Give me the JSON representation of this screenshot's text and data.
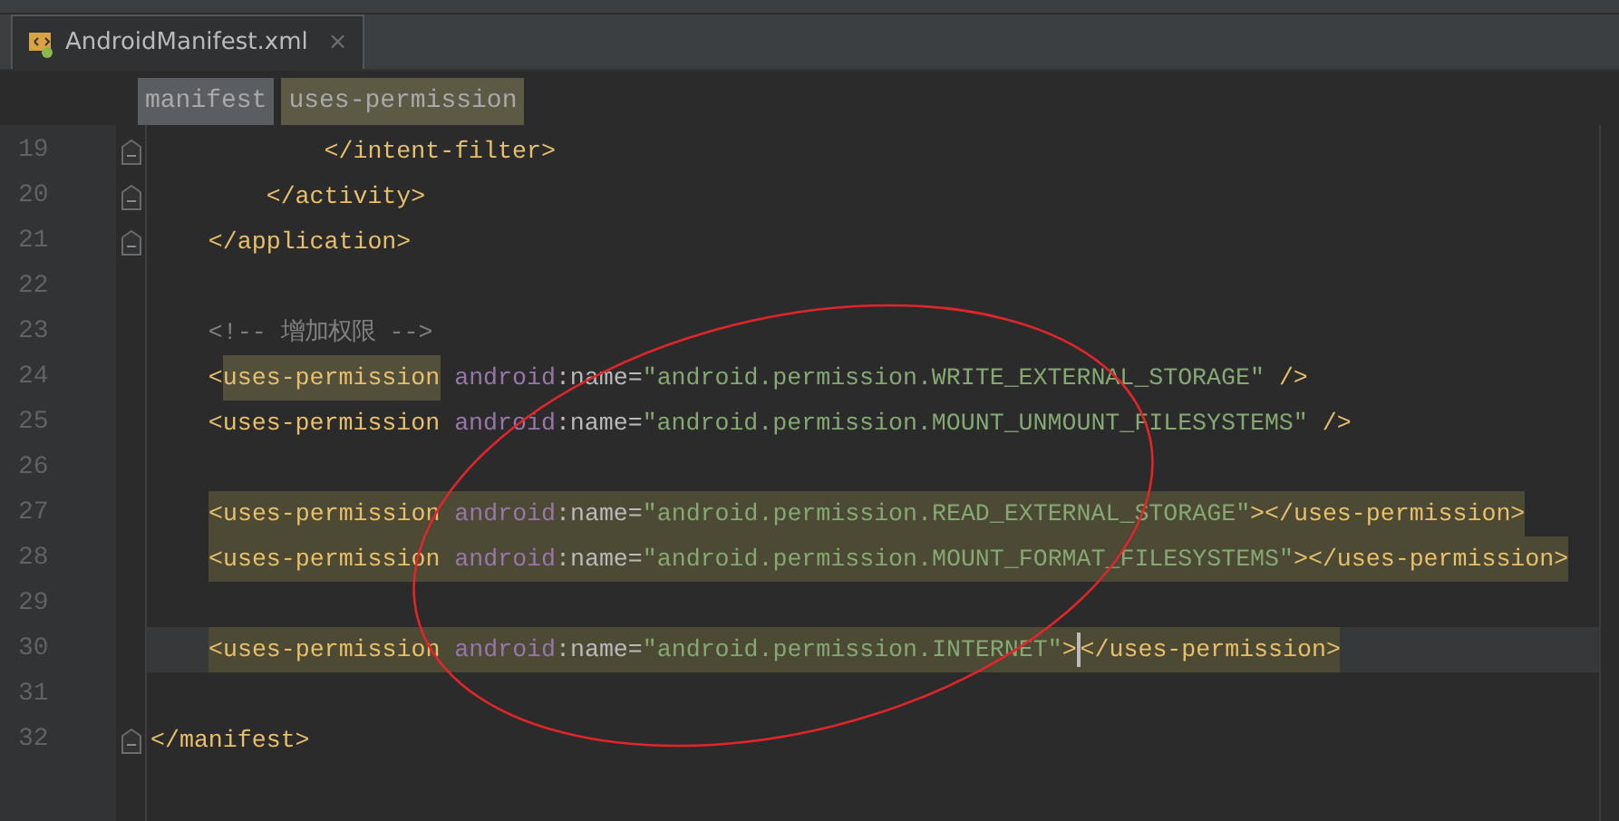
{
  "tab": {
    "title": "AndroidManifest.xml",
    "selected": true,
    "close": "×"
  },
  "breadcrumbs": [
    {
      "label": "manifest",
      "selected": false
    },
    {
      "label": "uses-permission",
      "selected": true
    }
  ],
  "lines": [
    {
      "number": "19",
      "fold": true,
      "highlighted": false,
      "current": false,
      "tokens": [
        {
          "kind": "tag",
          "text": "            </intent-filter>"
        }
      ]
    },
    {
      "number": "20",
      "fold": true,
      "highlighted": false,
      "current": false,
      "tokens": [
        {
          "kind": "tag",
          "text": "        </activity>"
        }
      ]
    },
    {
      "number": "21",
      "fold": true,
      "highlighted": false,
      "current": false,
      "tokens": [
        {
          "kind": "tag",
          "text": "    </application>"
        }
      ]
    },
    {
      "number": "22",
      "fold": false,
      "highlighted": false,
      "current": false
    },
    {
      "number": "23",
      "fold": false,
      "highlighted": false,
      "current": false,
      "tokens": [
        {
          "kind": "comment",
          "text": "    <!-- 增加权限 -->"
        }
      ]
    },
    {
      "number": "24",
      "fold": false,
      "highlighted": false,
      "current": false,
      "tokens": [
        {
          "kind": "tag",
          "text": "    <"
        },
        {
          "kind": "tag",
          "text": "uses-permission",
          "highlighted": true
        },
        {
          "kind": "ns",
          "text": " android"
        },
        {
          "kind": "attr",
          "text": ":name="
        },
        {
          "kind": "string",
          "text": "\"android.permission.WRITE_EXTERNAL_STORAGE\""
        },
        {
          "kind": "tag",
          "text": " />"
        }
      ]
    },
    {
      "number": "25",
      "fold": false,
      "highlighted": false,
      "current": false,
      "tokens": [
        {
          "kind": "tag",
          "text": "    <uses-permission"
        },
        {
          "kind": "ns",
          "text": " android"
        },
        {
          "kind": "attr",
          "text": ":name="
        },
        {
          "kind": "string",
          "text": "\"android.permission.MOUNT_UNMOUNT_FILESYSTEMS\""
        },
        {
          "kind": "tag",
          "text": " />"
        }
      ]
    },
    {
      "number": "26",
      "fold": false,
      "highlighted": false,
      "current": false
    },
    {
      "number": "27",
      "fold": false,
      "highlighted": true,
      "current": false,
      "tokens": [
        {
          "kind": "tag",
          "text": "<uses-permission"
        },
        {
          "kind": "ns",
          "text": " android"
        },
        {
          "kind": "attr",
          "text": ":name="
        },
        {
          "kind": "string",
          "text": "\"android.permission.READ_EXTERNAL_STORAGE\""
        },
        {
          "kind": "tag",
          "text": "></uses-permission>"
        }
      ]
    },
    {
      "number": "28",
      "fold": false,
      "highlighted": true,
      "current": false,
      "tokens": [
        {
          "kind": "tag",
          "text": "<uses-permission"
        },
        {
          "kind": "ns",
          "text": " android"
        },
        {
          "kind": "attr",
          "text": ":name="
        },
        {
          "kind": "string",
          "text": "\"android.permission.MOUNT_FORMAT_FILESYSTEMS\""
        },
        {
          "kind": "tag",
          "text": "></uses-permission>"
        }
      ]
    },
    {
      "number": "29",
      "fold": false,
      "highlighted": false,
      "current": false
    },
    {
      "number": "30",
      "fold": false,
      "highlighted": true,
      "current": true,
      "tokens": [
        {
          "kind": "tag",
          "text": "<uses-permission"
        },
        {
          "kind": "ns",
          "text": " android"
        },
        {
          "kind": "attr",
          "text": ":name="
        },
        {
          "kind": "string",
          "text": "\"android.permission.INTERNET\""
        },
        {
          "kind": "tag",
          "text": ">"
        },
        {
          "kind": "caret"
        },
        {
          "kind": "tag",
          "text": "</uses-permission>"
        }
      ]
    },
    {
      "number": "31",
      "fold": false,
      "highlighted": false,
      "current": false
    },
    {
      "number": "32",
      "fold": true,
      "highlighted": false,
      "current": false,
      "tokens": [
        {
          "kind": "tag",
          "text": "</manifest>"
        }
      ]
    }
  ]
}
